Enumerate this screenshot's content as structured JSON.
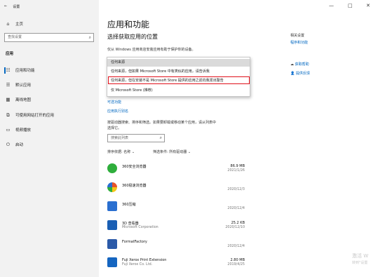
{
  "window": {
    "title": "设置",
    "controls": [
      "—",
      "□",
      "✕"
    ]
  },
  "sidebar": {
    "home_label": "主页",
    "search_placeholder": "查找设置",
    "section_label": "应用",
    "items": [
      {
        "label": "应用和功能",
        "icon": "apps-list-icon",
        "glyph": "☷"
      },
      {
        "label": "默认应用",
        "icon": "default-apps-icon",
        "glyph": "☰"
      },
      {
        "label": "离线地图",
        "icon": "offline-maps-icon",
        "glyph": "🗺"
      },
      {
        "label": "可使用网站打开的应用",
        "icon": "apps-for-websites-icon",
        "glyph": "⧉"
      },
      {
        "label": "视频播放",
        "icon": "video-playback-icon",
        "glyph": "▭"
      },
      {
        "label": "启动",
        "icon": "startup-icon",
        "glyph": "⏻"
      }
    ]
  },
  "main": {
    "title": "应用和功能",
    "choose_location_heading": "选择获取应用的位置",
    "choose_location_desc": "仅从 Windows 应用商店安装应用有助于保护你的设备。",
    "dropdown": {
      "options": [
        "任何来源",
        "任何来源，但如果 Microsoft Store 中有类似的应用，请告诉我",
        "任何来源，但在安装不是 Microsoft Store 提供的应用之前向我发出警告",
        "仅 Microsoft Store (推荐)"
      ],
      "selected_index": 0,
      "highlighted_index": 2
    },
    "optional_features_link": "可选功能",
    "app_aliases_link": "应用执行别名",
    "search_desc_line1": "按驱动器搜索、排序和筛选。如果要卸载或移动某个应用，请从列表中",
    "search_desc_line2": "选择它。",
    "list_search_placeholder": "搜索此列表",
    "sort_label": "排序依据: 名称",
    "filter_label": "筛选条件: 所有驱动器",
    "apps": [
      {
        "name": "360安全浏览器",
        "publisher": "",
        "size": "86.9 MB",
        "date": "2021/1/26",
        "icon": "360-browser-icon",
        "color": "#2fae3c"
      },
      {
        "name": "360极速浏览器",
        "publisher": "",
        "size": "",
        "date": "2020/12/3",
        "icon": "360-chrome-icon",
        "color": "#e8532a"
      },
      {
        "name": "360压缩",
        "publisher": "",
        "size": "",
        "date": "2020/12/4",
        "icon": "360-zip-icon",
        "color": "#2a6fd0"
      },
      {
        "name": "3D 查看器",
        "publisher": "Microsoft Corporation",
        "size": "25.2 KB",
        "date": "2020/12/10",
        "icon": "3d-viewer-icon",
        "color": "#1a5fb4"
      },
      {
        "name": "FormatFactory",
        "publisher": "",
        "size": "",
        "date": "2020/12/4",
        "icon": "format-factory-icon",
        "color": "#2b5aa8"
      },
      {
        "name": "Fuji Xerox Print Extension",
        "publisher": "Fuji Xerox Co. Ltd.",
        "size": "2.80 MB",
        "date": "2019/4/25",
        "icon": "fuji-xerox-icon",
        "color": "#1565c0"
      }
    ]
  },
  "related": {
    "heading": "相关设置",
    "link": "程序和功能",
    "help_link": "获取帮助",
    "feedback_link": "提供反馈"
  },
  "watermark": {
    "line1": "激活 W",
    "line2": "转到\"设置"
  }
}
